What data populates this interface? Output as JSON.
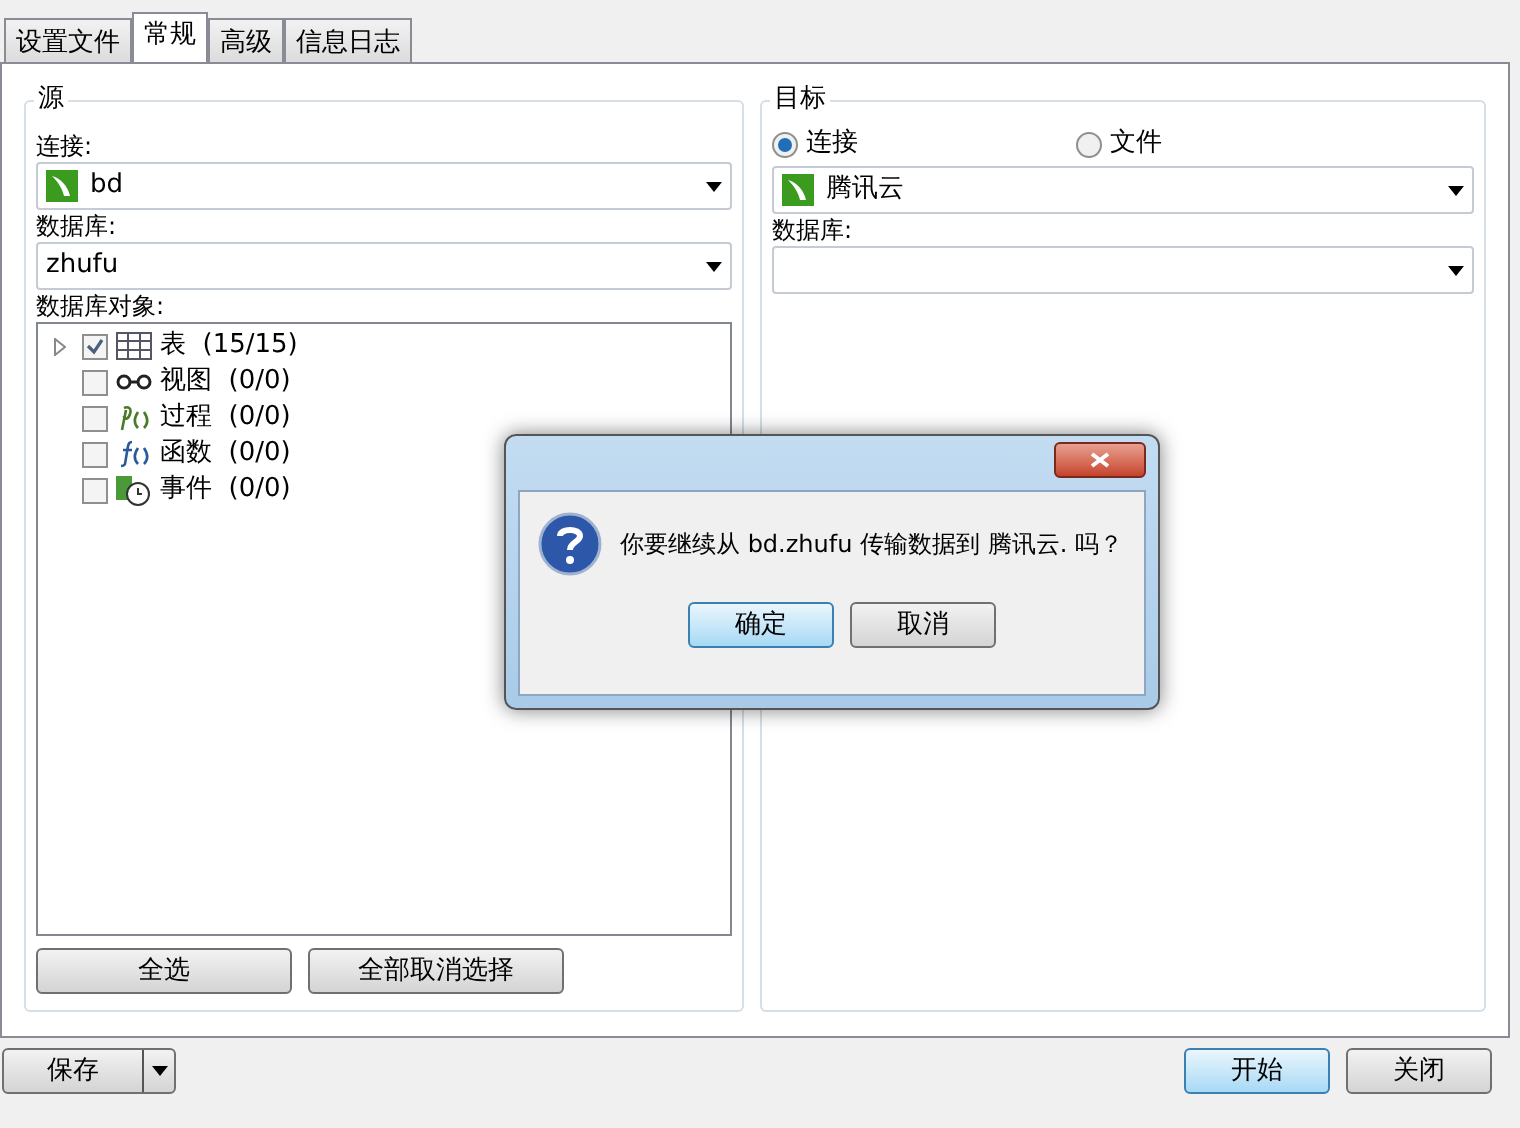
{
  "tabs": [
    {
      "label": "设置文件",
      "selected": false
    },
    {
      "label": "常规",
      "selected": true
    },
    {
      "label": "高级",
      "selected": false
    },
    {
      "label": "信息日志",
      "selected": false
    }
  ],
  "source": {
    "title": "源",
    "connection_label": "连接:",
    "connection": "bd",
    "database_label": "数据库:",
    "database": "zhufu",
    "objects_label": "数据库对象:",
    "objects": [
      {
        "kind": "table",
        "label": "表",
        "count": "(15/15)",
        "checked": true,
        "expandable": true
      },
      {
        "kind": "view",
        "label": "视图",
        "count": "(0/0)",
        "checked": false,
        "expandable": false
      },
      {
        "kind": "procedure",
        "label": "过程",
        "count": "(0/0)",
        "checked": false,
        "expandable": false
      },
      {
        "kind": "function",
        "label": "函数",
        "count": "(0/0)",
        "checked": false,
        "expandable": false
      },
      {
        "kind": "event",
        "label": "事件",
        "count": "(0/0)",
        "checked": false,
        "expandable": false
      }
    ],
    "buttons": [
      "全选",
      "全部取消选择"
    ]
  },
  "target": {
    "title": "目标",
    "modes": [
      {
        "label": "连接",
        "selected": true
      },
      {
        "label": "文件",
        "selected": false
      }
    ],
    "connection": "腾讯云",
    "database_label": "数据库:"
  },
  "footer": {
    "save": "保存",
    "start": "开始",
    "close": "关闭"
  },
  "dialog": {
    "message": "你要继续从 bd.zhufu 传输数据到 腾讯云. 吗？",
    "buttons": [
      {
        "label": "确定",
        "default": true
      },
      {
        "label": "取消",
        "default": false
      }
    ]
  }
}
